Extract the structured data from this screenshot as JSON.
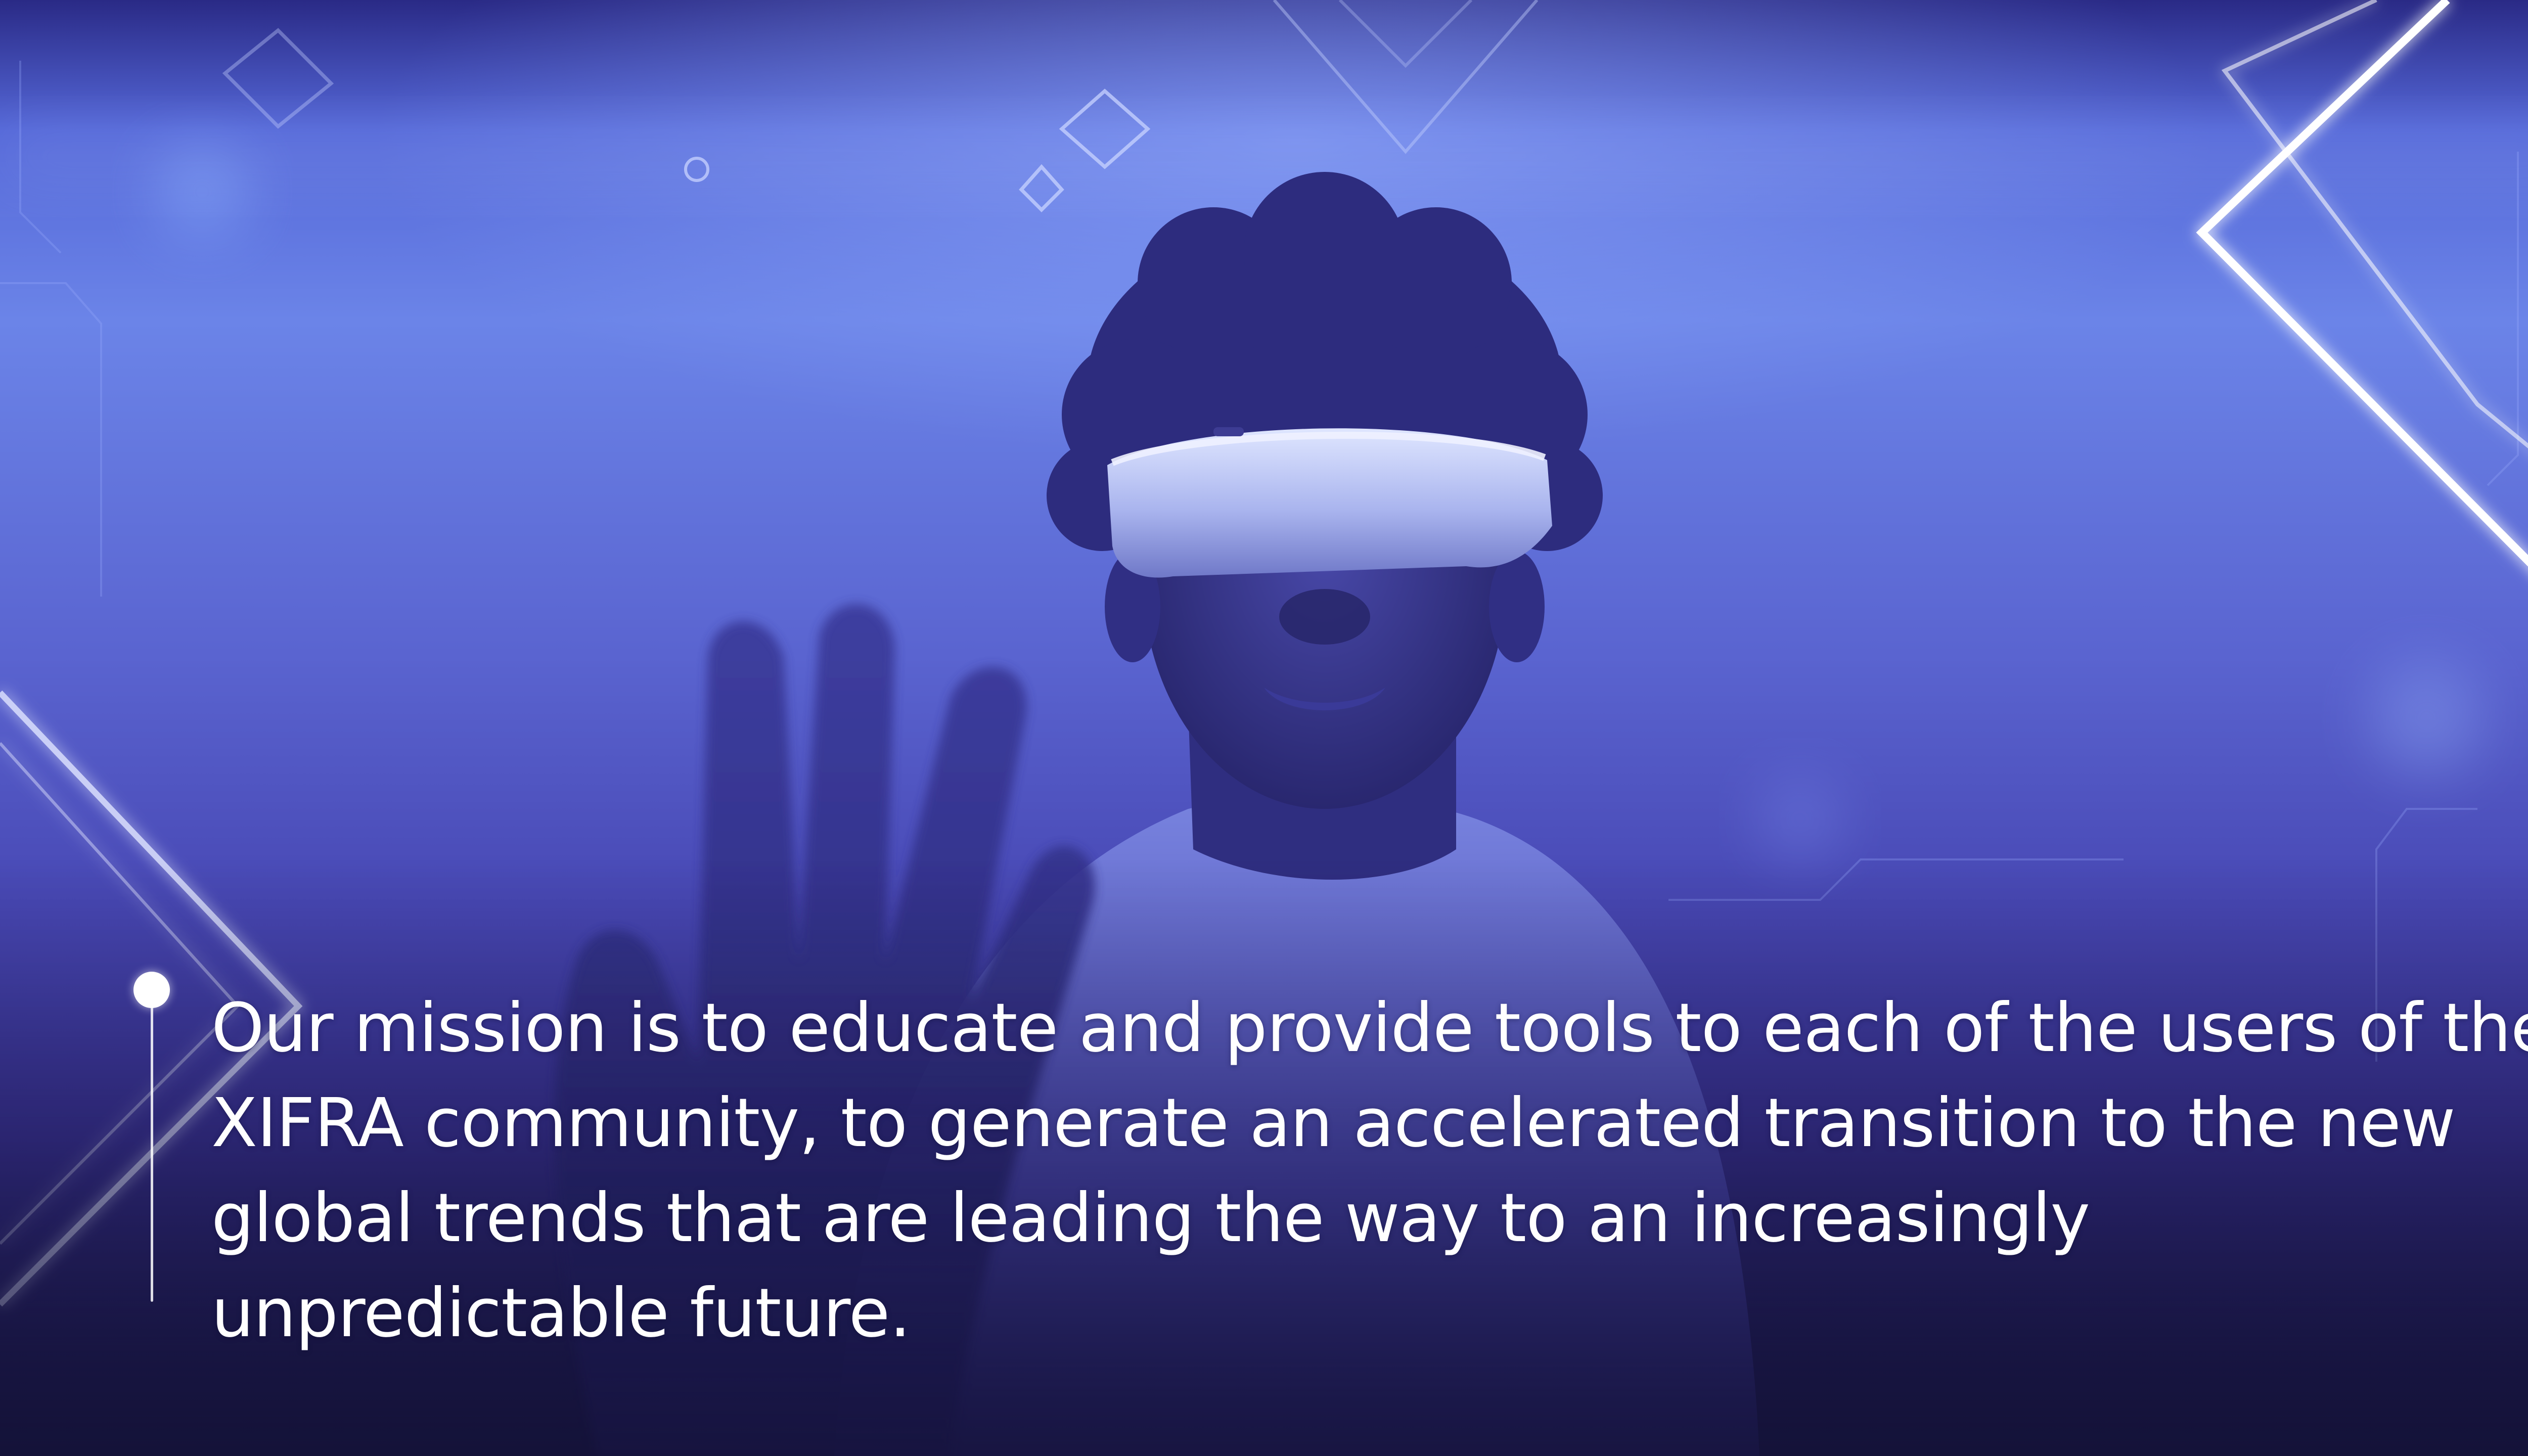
{
  "scene": {
    "subject": "person-wearing-vr-headset",
    "palette": {
      "top": "#2a2a86",
      "mid": "#6b84e8",
      "bottom": "#17163e",
      "glow": "#ffffff"
    }
  },
  "mission": {
    "text": "Our mission is to educate and provide tools to each of the users of the XIFRA community, to generate an accelerated transition to the new global trends that are leading the way to an increasingly unpredictable future."
  }
}
